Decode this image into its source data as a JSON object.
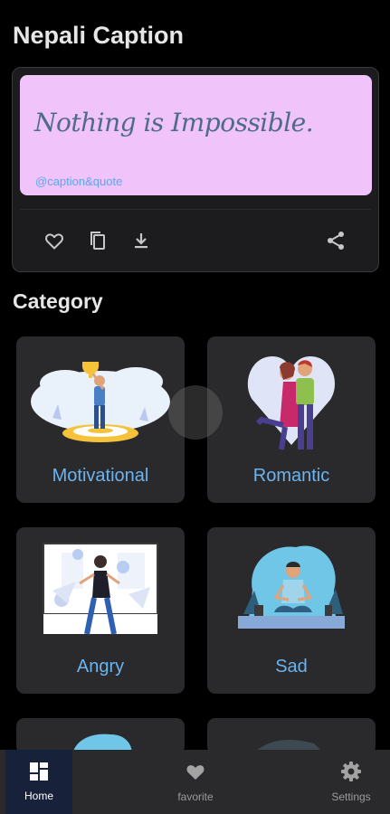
{
  "app": {
    "title": "Nepali Caption"
  },
  "quote": {
    "text": "Nothing is Impossible.",
    "handle": "@caption&quote",
    "bg_color": "#f0c3fb"
  },
  "actions": [
    {
      "icon": "heart-outline-icon"
    },
    {
      "icon": "copy-icon"
    },
    {
      "icon": "download-icon"
    },
    {
      "icon": "share-icon"
    }
  ],
  "section": {
    "title": "Category"
  },
  "categories": [
    {
      "label": "Motivational"
    },
    {
      "label": "Romantic"
    },
    {
      "label": "Angry"
    },
    {
      "label": "Sad"
    }
  ],
  "nav": [
    {
      "label": "Home",
      "icon": "dashboard-icon",
      "active": true
    },
    {
      "label": "favorite",
      "icon": "heart-icon",
      "active": false
    },
    {
      "label": "Settings",
      "icon": "gear-icon",
      "active": false
    }
  ],
  "colors": {
    "accent": "#6ab4f0",
    "background": "#000000",
    "card": "#2a2a2c"
  }
}
